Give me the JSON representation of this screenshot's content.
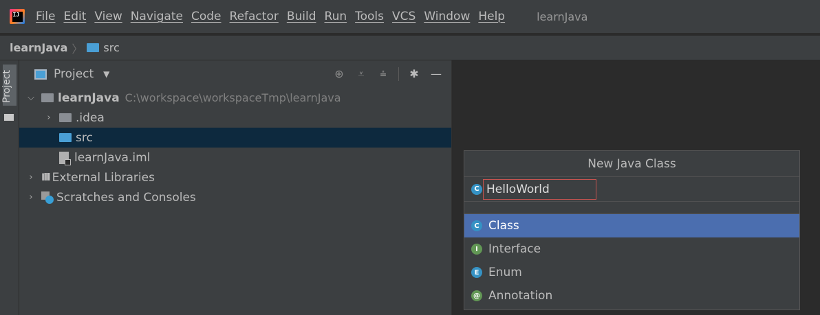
{
  "menubar": {
    "items": [
      "File",
      "Edit",
      "View",
      "Navigate",
      "Code",
      "Refactor",
      "Build",
      "Run",
      "Tools",
      "VCS",
      "Window",
      "Help"
    ],
    "window_title": "learnJava",
    "logo_text": "IJ"
  },
  "navbar": {
    "project": "learnJava",
    "folder": "src"
  },
  "sidestrip": {
    "tab_label": "Project"
  },
  "project_panel": {
    "title": "Project",
    "tools": [
      "locate-icon",
      "expand-all-icon",
      "collapse-all-icon",
      "gear-icon",
      "minimize-icon"
    ],
    "tree": {
      "root_name": "learnJava",
      "root_path": "C:\\workspace\\workspaceTmp\\learnJava",
      "idea": ".idea",
      "src": "src",
      "iml": "learnJava.iml",
      "external_libraries": "External Libraries",
      "scratches": "Scratches and Consoles"
    }
  },
  "dialog": {
    "title": "New Java Class",
    "name_value": "HelloWorld",
    "kinds": [
      {
        "label": "Class",
        "badge": "C"
      },
      {
        "label": "Interface",
        "badge": "I"
      },
      {
        "label": "Enum",
        "badge": "E"
      },
      {
        "label": "Annotation",
        "badge": "@"
      }
    ],
    "selected_kind": "Class"
  },
  "colors": {
    "selection_dark": "#0d293e",
    "selection_blue": "#4b6eaf",
    "error_border": "#c75450",
    "class_badge": "#3592c4",
    "interface_badge": "#629755"
  }
}
